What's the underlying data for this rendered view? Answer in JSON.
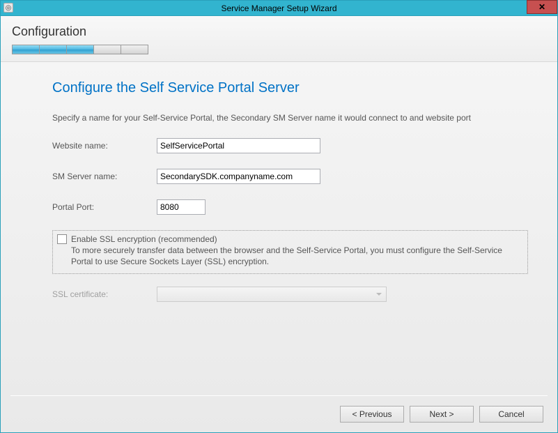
{
  "titlebar": {
    "title": "Service Manager Setup Wizard"
  },
  "header": {
    "section_label": "Configuration"
  },
  "page": {
    "heading": "Configure the Self Service Portal Server",
    "description": "Specify a name for your Self-Service Portal, the Secondary SM Server name it would connect to and website port"
  },
  "fields": {
    "website_label": "Website name:",
    "website_value": "SelfServicePortal",
    "sm_server_label": "SM Server name:",
    "sm_server_value": "SecondarySDK.companyname.com",
    "portal_port_label": "Portal Port:",
    "portal_port_value": "8080",
    "ssl_cert_label": "SSL certificate:"
  },
  "ssl": {
    "enable_label": "Enable SSL encryption (recommended)",
    "enable_desc": "To more securely transfer data between the browser and the Self-Service Portal, you must configure the Self-Service Portal to use Secure Sockets Layer (SSL) encryption."
  },
  "buttons": {
    "previous": "< Previous",
    "next": "Next >",
    "cancel": "Cancel"
  }
}
